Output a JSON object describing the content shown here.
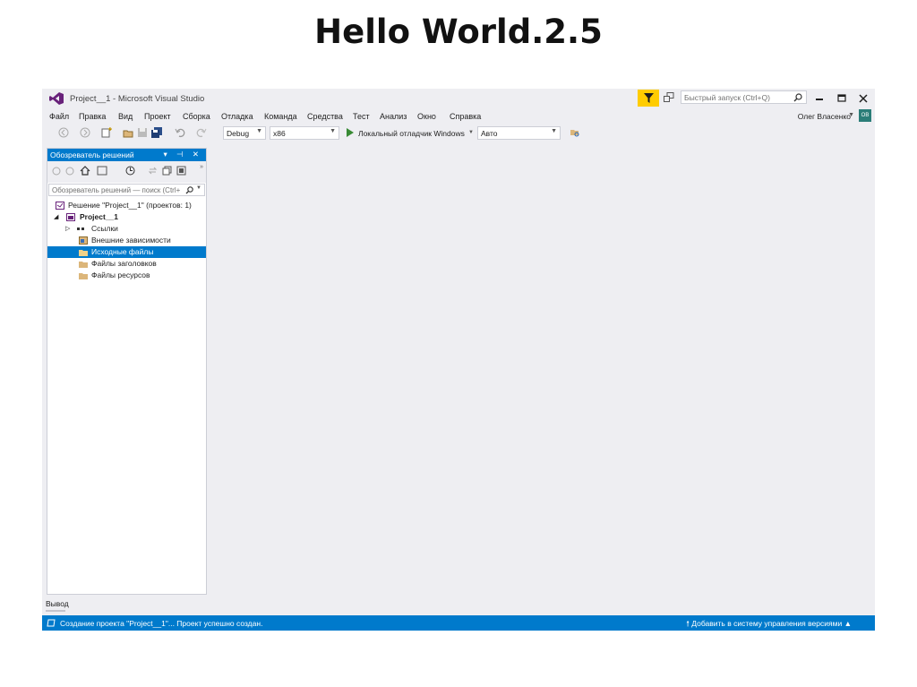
{
  "slide": {
    "title": "Hello World.2.5"
  },
  "window": {
    "title": "Project__1 - Microsoft Visual Studio",
    "quick_launch_placeholder": "Быстрый запуск (Ctrl+Q)",
    "user_name": "Олег Власенко",
    "user_initials": "ОВ",
    "accent": "#007acc",
    "filter_color": "#ffcc00"
  },
  "menu": [
    "Файл",
    "Правка",
    "Вид",
    "Проект",
    "Сборка",
    "Отладка",
    "Команда",
    "Средства",
    "Тест",
    "Анализ",
    "Окно",
    "Справка"
  ],
  "toolbar": {
    "config": "Debug",
    "platform": "x86",
    "run_target": "Локальный отладчик Windows",
    "mode": "Авто"
  },
  "solution_explorer": {
    "title": "Обозреватель решений",
    "search_placeholder": "Обозреватель решений — поиск (Ctrl+",
    "items": [
      {
        "label": "Решение \"Project__1\"  (проектов: 1)"
      },
      {
        "label": "Project__1"
      },
      {
        "label": "Ссылки"
      },
      {
        "label": "Внешние зависимости"
      },
      {
        "label": "Исходные файлы"
      },
      {
        "label": "Файлы заголовков"
      },
      {
        "label": "Файлы ресурсов"
      }
    ],
    "selected_index": 4
  },
  "output": {
    "tab_label": "Вывод"
  },
  "status": {
    "message": "Создание проекта \"Project__1\"... Проект успешно создан.",
    "vc_label": "Добавить в систему управления версиями"
  }
}
